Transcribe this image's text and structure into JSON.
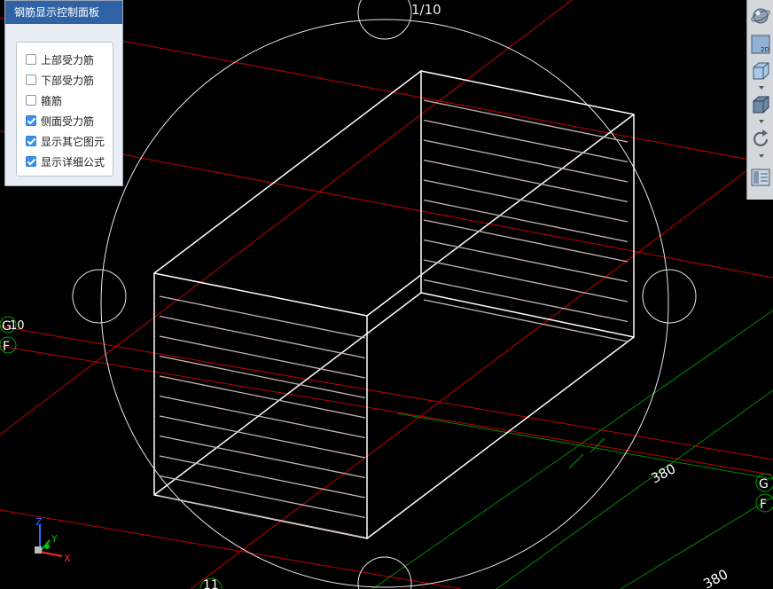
{
  "panel": {
    "title": "钢筋显示控制面板",
    "options": [
      {
        "label": "上部受力筋",
        "checked": false
      },
      {
        "label": "下部受力筋",
        "checked": false
      },
      {
        "label": "箍筋",
        "checked": false
      },
      {
        "label": "侧面受力筋",
        "checked": true
      },
      {
        "label": "显示其它图元",
        "checked": true
      },
      {
        "label": "显示详细公式",
        "checked": true
      }
    ]
  },
  "viewport": {
    "top_label": "1/10",
    "axis_labels": {
      "left_upper": "G",
      "left_upper_number": "10",
      "left_lower": "F",
      "right_upper": "G",
      "right_lower": "F",
      "bottom": "11"
    },
    "dimensions": {
      "right_mid": "380",
      "bottom_right": "380"
    },
    "axes": {
      "x": "X",
      "y": "Y",
      "z": "Z"
    }
  },
  "toolbar": {
    "items": [
      "orbit-icon",
      "view-2d-icon",
      "view-3d-box-icon",
      "view-3d-solid-icon",
      "rotate-icon",
      "layout-icon"
    ],
    "view_2d_label": "2D"
  },
  "colors": {
    "background": "#000000",
    "axis_red": "#c40000",
    "axis_green": "#008a00",
    "wireframe": "#ffffff",
    "rebar": "#c8b4b4",
    "panel_title": "#2f63a6"
  }
}
